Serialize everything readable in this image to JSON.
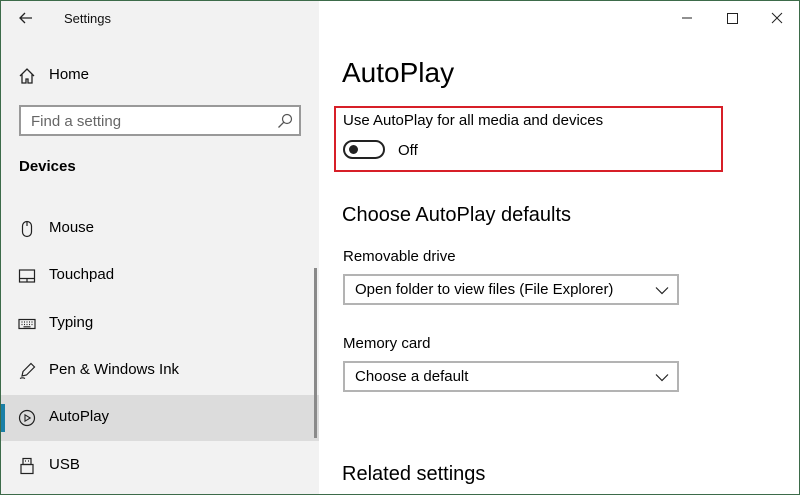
{
  "window": {
    "title": "Settings"
  },
  "sidebar": {
    "home_label": "Home",
    "search_placeholder": "Find a setting",
    "section_title": "Devices",
    "items": [
      {
        "label": "Mouse",
        "icon": "mouse-icon"
      },
      {
        "label": "Touchpad",
        "icon": "touchpad-icon"
      },
      {
        "label": "Typing",
        "icon": "keyboard-icon"
      },
      {
        "label": "Pen & Windows Ink",
        "icon": "pen-icon"
      },
      {
        "label": "AutoPlay",
        "icon": "autoplay-icon",
        "selected": true
      },
      {
        "label": "USB",
        "icon": "usb-icon"
      }
    ]
  },
  "main": {
    "title": "AutoPlay",
    "autoplay_toggle": {
      "label": "Use AutoPlay for all media and devices",
      "state": "Off"
    },
    "defaults_heading": "Choose AutoPlay defaults",
    "removable_drive": {
      "label": "Removable drive",
      "value": "Open folder to view files (File Explorer)"
    },
    "memory_card": {
      "label": "Memory card",
      "value": "Choose a default"
    },
    "related_heading": "Related settings"
  },
  "colors": {
    "accent": "#1a7fa6",
    "highlight_border": "#d71f28",
    "sidebar_bg": "#f2f2f2"
  }
}
